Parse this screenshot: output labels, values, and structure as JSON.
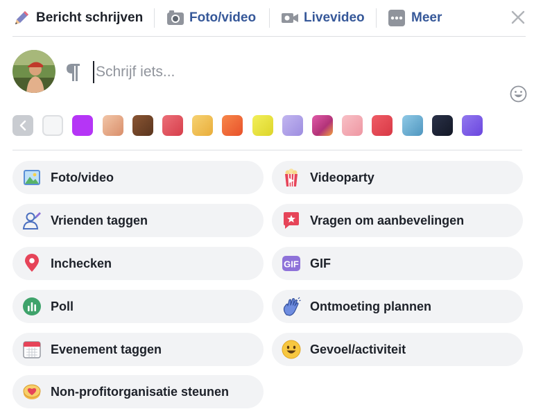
{
  "tabs": [
    {
      "label": "Bericht schrijven",
      "icon": "pencil-icon",
      "active": true
    },
    {
      "label": "Foto/video",
      "icon": "camera-icon",
      "active": false
    },
    {
      "label": "Livevideo",
      "icon": "video-camera-icon",
      "active": false
    },
    {
      "label": "Meer",
      "icon": "more-dots-icon",
      "active": false
    }
  ],
  "composer": {
    "placeholder": "Schrijf iets..."
  },
  "background_swatches": [
    "#f5f6f7",
    "#b535f6",
    "#e7a886",
    "#6e4227",
    "#e05561",
    "#f1c054",
    "#f06b3a",
    "#e6e13c",
    "#ad9ee8",
    "#c8418f",
    "#f4a9b1",
    "#e64c57",
    "#6bb3d6",
    "#1d2436",
    "#7b5ce5"
  ],
  "options": [
    {
      "label": "Foto/video",
      "icon": "photo-icon"
    },
    {
      "label": "Videoparty",
      "icon": "popcorn-icon"
    },
    {
      "label": "Vrienden taggen",
      "icon": "tag-friends-icon"
    },
    {
      "label": "Vragen om aanbevelingen",
      "icon": "recommendation-icon"
    },
    {
      "label": "Inchecken",
      "icon": "location-pin-icon"
    },
    {
      "label": "GIF",
      "icon": "gif-icon"
    },
    {
      "label": "Poll",
      "icon": "poll-icon"
    },
    {
      "label": "Ontmoeting plannen",
      "icon": "wave-hand-icon"
    },
    {
      "label": "Evenement taggen",
      "icon": "calendar-icon"
    },
    {
      "label": "Gevoel/activiteit",
      "icon": "smiley-icon"
    },
    {
      "label": "Non-profitorganisatie steunen",
      "icon": "donate-heart-icon"
    }
  ]
}
